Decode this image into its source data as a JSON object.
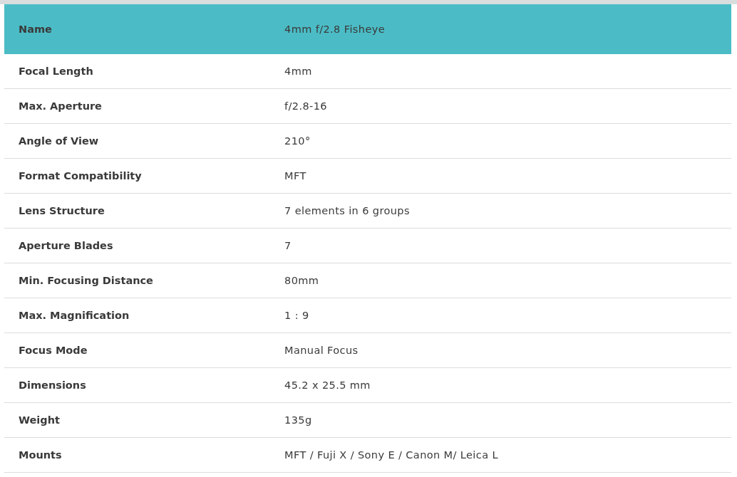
{
  "header": {
    "label": "Name",
    "value": "4mm f/2.8 Fisheye"
  },
  "rows": [
    {
      "label": "Focal Length",
      "value": "4mm"
    },
    {
      "label": "Max. Aperture",
      "value": "f/2.8-16"
    },
    {
      "label": "Angle of View",
      "value": "210°"
    },
    {
      "label": "Format Compatibility",
      "value": "MFT"
    },
    {
      "label": "Lens Structure",
      "value": "7 elements in 6 groups"
    },
    {
      "label": "Aperture Blades",
      "value": "7"
    },
    {
      "label": "Min. Focusing Distance",
      "value": "80mm"
    },
    {
      "label": "Max. Magnification",
      "value": "1 : 9"
    },
    {
      "label": "Focus Mode",
      "value": "Manual Focus"
    },
    {
      "label": "Dimensions",
      "value": "45.2 x 25.5 mm"
    },
    {
      "label": "Weight",
      "value": "135g"
    },
    {
      "label": "Mounts",
      "value": "MFT / Fuji X / Sony E / Canon M/ Leica L"
    }
  ]
}
